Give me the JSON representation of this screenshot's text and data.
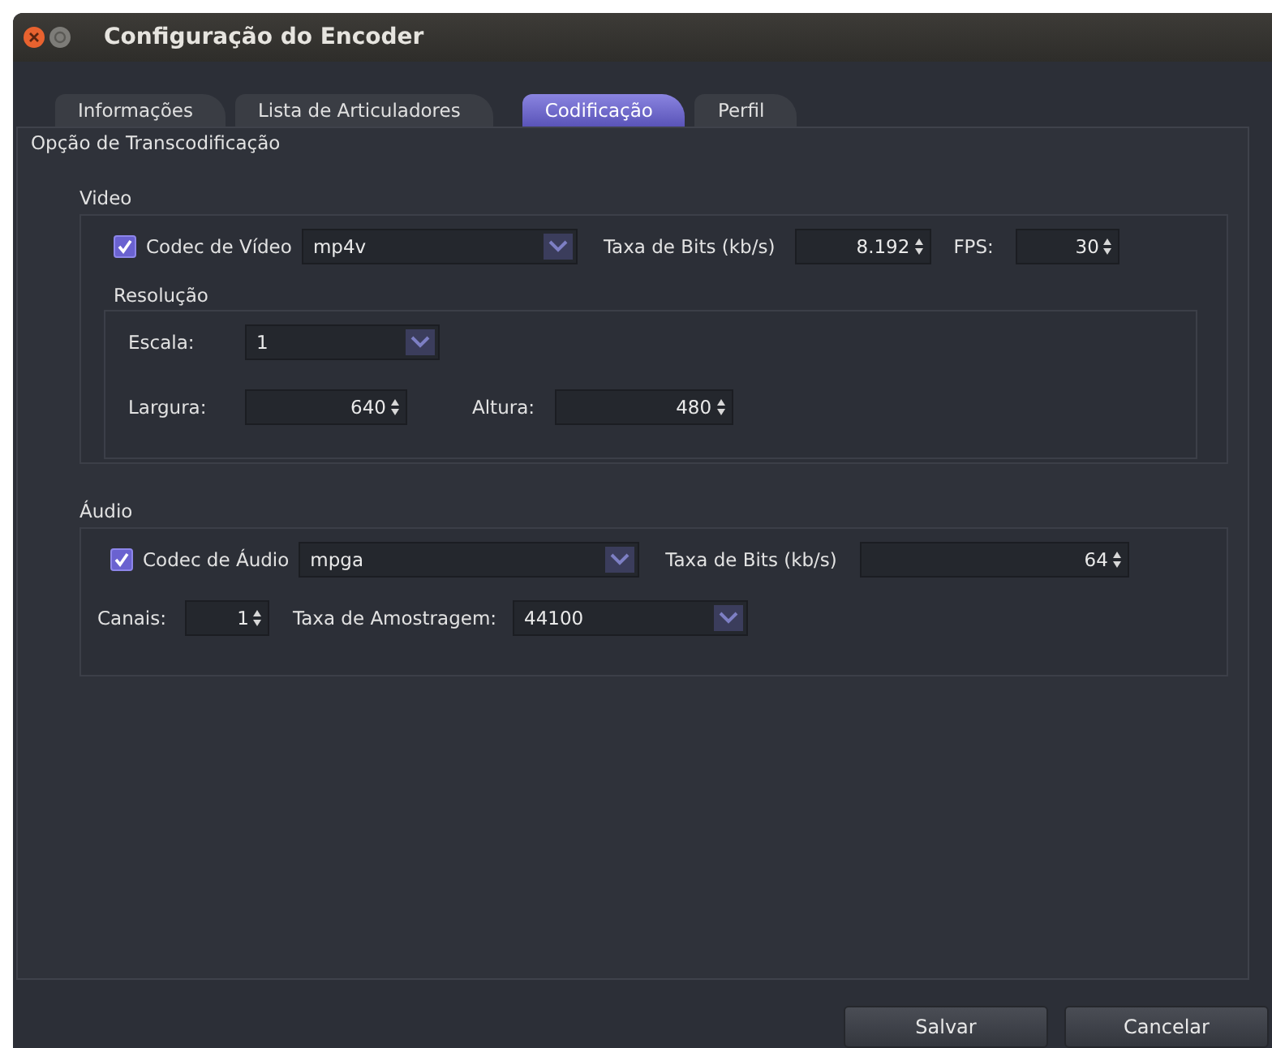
{
  "window": {
    "title": "Configuração do Encoder"
  },
  "tabs": [
    {
      "label": "Informações",
      "selected": false
    },
    {
      "label": "Lista de Articuladores",
      "selected": false
    },
    {
      "label": "Codificação",
      "selected": true
    },
    {
      "label": "Perfil",
      "selected": false
    }
  ],
  "section_title": "Opção de Transcodificação",
  "video": {
    "title": "Video",
    "codec": {
      "label": "Codec de Vídeo",
      "checked": true,
      "value": "mp4v"
    },
    "bitrate": {
      "label": "Taxa de Bits (kb/s)",
      "value": "8.192"
    },
    "fps": {
      "label": "FPS:",
      "value": "30"
    },
    "resolution": {
      "title": "Resolução",
      "scale": {
        "label": "Escala:",
        "value": "1"
      },
      "width": {
        "label": "Largura:",
        "value": "640"
      },
      "height": {
        "label": "Altura:",
        "value": "480"
      }
    }
  },
  "audio": {
    "title": "Áudio",
    "codec": {
      "label": "Codec de Áudio",
      "checked": true,
      "value": "mpga"
    },
    "bitrate": {
      "label": "Taxa de Bits (kb/s)",
      "value": "64"
    },
    "channels": {
      "label": "Canais:",
      "value": "1"
    },
    "sample_rate": {
      "label": "Taxa de Amostragem:",
      "value": "44100"
    }
  },
  "buttons": [
    {
      "label": "Salvar"
    },
    {
      "label": "Cancelar"
    }
  ]
}
